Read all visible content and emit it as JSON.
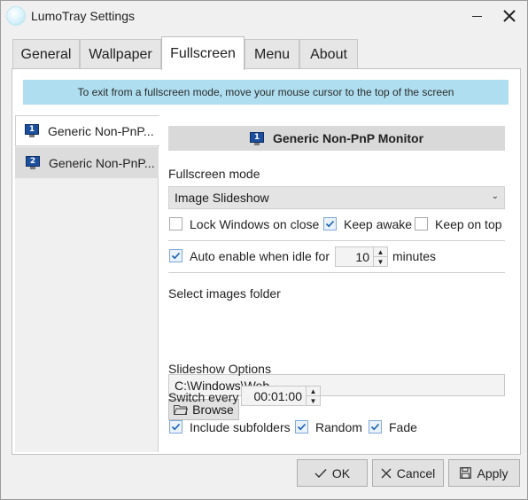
{
  "window": {
    "title": "LumoTray Settings",
    "icon": "lumotray-app-icon"
  },
  "tabs": [
    {
      "label": "General",
      "active": false
    },
    {
      "label": "Wallpaper",
      "active": false
    },
    {
      "label": "Fullscreen",
      "active": true
    },
    {
      "label": "Menu",
      "active": false
    },
    {
      "label": "About",
      "active": false
    }
  ],
  "fullscreen": {
    "info": "To exit from a fullscreen mode, move your mouse cursor to the top of the screen",
    "monitors": [
      {
        "number": "1",
        "label": "Generic Non-PnP...",
        "selected": true
      },
      {
        "number": "2",
        "label": "Generic Non-PnP...",
        "selected": false
      }
    ],
    "selected_monitor": {
      "number": "1",
      "name": "Generic Non-PnP Monitor"
    },
    "mode_label": "Fullscreen mode",
    "mode_value": "Image Slideshow",
    "lock_windows_label": "Lock Windows on close",
    "lock_windows_checked": false,
    "keep_awake_label": "Keep awake",
    "keep_awake_checked": true,
    "keep_on_top_label": "Keep on top",
    "keep_on_top_checked": false,
    "auto_enable_label": "Auto enable when idle for",
    "auto_enable_checked": true,
    "idle_minutes": "10",
    "minutes_label": "minutes",
    "folder_label": "Select images folder",
    "folder_path": "C:\\Windows\\Web",
    "browse_label": "Browse",
    "slideshow_options_label": "Slideshow Options",
    "switch_every_label": "Switch every",
    "switch_every_value": "00:01:00",
    "include_subfolders_label": "Include subfolders",
    "include_subfolders_checked": true,
    "random_label": "Random",
    "random_checked": true,
    "fade_label": "Fade",
    "fade_checked": true
  },
  "footer": {
    "ok_label": "OK",
    "cancel_label": "Cancel",
    "apply_label": "Apply"
  },
  "colors": {
    "info_banner": "#aedeef",
    "monitor_icon": "#1c4f9c",
    "window_bg": "#f0f0f0"
  }
}
